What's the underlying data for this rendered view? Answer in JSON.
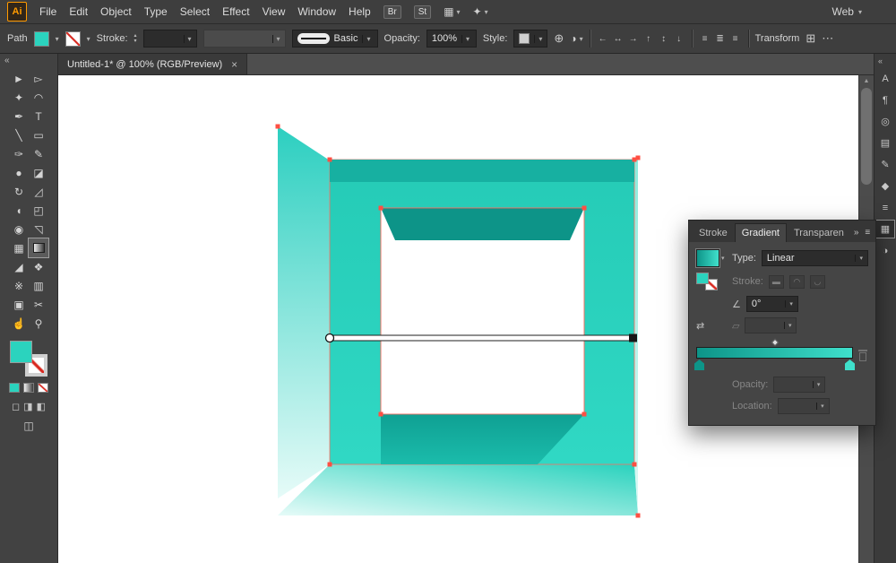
{
  "colors": {
    "teal": "#2BD3BE",
    "teal_dark": "#0D9488",
    "teal_light": "#D9F8F3",
    "anchor_red": "#FF4F43",
    "bar_bg": "#3E3E3E",
    "panel_bg": "#454545",
    "canvas_bg": "#FFFFFF"
  },
  "glyphs": {
    "caret": "▾",
    "stepper_up": "▴",
    "stepper_down": "▾",
    "scroll_up": "▲"
  },
  "menu_bar": {
    "app_badge": "Ai",
    "items": [
      "File",
      "Edit",
      "Object",
      "Type",
      "Select",
      "Effect",
      "View",
      "Window",
      "Help"
    ],
    "bridge_button": "Br",
    "stock_button": "St",
    "arrange_glyph": "▦",
    "live_glyph": "✦",
    "workspace": "Web"
  },
  "control_bar": {
    "selection_label": "Path",
    "stroke_label": "Stroke:",
    "brush_label": "Basic",
    "opacity_label": "Opacity:",
    "opacity_value": "100%",
    "style_label": "Style:",
    "transform_label": "Transform",
    "globe_glyph": "⊕",
    "recolor_glyph": "◑",
    "align_icons": [
      "←",
      "↔",
      "→",
      "↑",
      "↕",
      "↓"
    ],
    "distribute_icons": [
      "≡",
      "≣",
      "≡"
    ],
    "grid_glyph": "⊞",
    "overflow_glyph": "⋯"
  },
  "document_tab": {
    "title": "Untitled-1* @ 100% (RGB/Preview)",
    "close_glyph": "×"
  },
  "toolbar": {
    "collapse_glyph": "«",
    "tools": [
      {
        "name": "selection",
        "glyph": "►"
      },
      {
        "name": "direct-selection",
        "glyph": "▻"
      },
      {
        "name": "magic-wand",
        "glyph": "✦"
      },
      {
        "name": "lasso",
        "glyph": "◠"
      },
      {
        "name": "pen",
        "glyph": "✒"
      },
      {
        "name": "type",
        "glyph": "T"
      },
      {
        "name": "line-segment",
        "glyph": "╲"
      },
      {
        "name": "rectangle",
        "glyph": "▭"
      },
      {
        "name": "paintbrush",
        "glyph": "✑"
      },
      {
        "name": "pencil",
        "glyph": "✎"
      },
      {
        "name": "blob-brush",
        "glyph": "●"
      },
      {
        "name": "eraser",
        "glyph": "◪"
      },
      {
        "name": "rotate",
        "glyph": "↻"
      },
      {
        "name": "scale",
        "glyph": "◿"
      },
      {
        "name": "width",
        "glyph": "◖"
      },
      {
        "name": "free-transform",
        "glyph": "◰"
      },
      {
        "name": "shape-builder",
        "glyph": "◉"
      },
      {
        "name": "perspective-grid",
        "glyph": "◹"
      },
      {
        "name": "mesh",
        "glyph": "▦"
      },
      {
        "name": "gradient",
        "glyph": "■"
      },
      {
        "name": "eyedropper",
        "glyph": "◢"
      },
      {
        "name": "blend",
        "glyph": "❖"
      },
      {
        "name": "symbol-sprayer",
        "glyph": "※"
      },
      {
        "name": "column-graph",
        "glyph": "▥"
      },
      {
        "name": "artboard",
        "glyph": "▣"
      },
      {
        "name": "slice",
        "glyph": "✂"
      },
      {
        "name": "hand",
        "glyph": "☝"
      },
      {
        "name": "zoom",
        "glyph": "⚲"
      }
    ],
    "draw_modes": [
      "◻",
      "◨",
      "◧"
    ],
    "screen_mode": "◫"
  },
  "gradient_panel": {
    "tabs": [
      "Stroke",
      "Gradient",
      "Transparen"
    ],
    "expand_glyph": "»",
    "menu_glyph": "≡",
    "type_label": "Type:",
    "type_value": "Linear",
    "stroke_label": "Stroke:",
    "stroke_type_icons": [
      "▬",
      "◠",
      "◡"
    ],
    "angle_glyph": "∠",
    "angle_value": "0°",
    "reverse_glyph": "⇄",
    "aspect_glyph": "▱",
    "opacity_label": "Opacity:",
    "location_label": "Location:"
  },
  "dock": {
    "expand_glyph": "«",
    "icons": [
      {
        "name": "character-panel",
        "glyph": "A"
      },
      {
        "name": "paragraph-panel",
        "glyph": "¶"
      },
      {
        "name": "appearance-panel",
        "glyph": "◎"
      },
      {
        "name": "swatches-panel",
        "glyph": "▤"
      },
      {
        "name": "brushes-panel",
        "glyph": "✎"
      },
      {
        "name": "symbols-panel",
        "glyph": "◆"
      },
      {
        "name": "stroke-panel",
        "glyph": "≡"
      },
      {
        "name": "gradient-panel",
        "glyph": "▦"
      },
      {
        "name": "transparency-panel",
        "glyph": "◑"
      }
    ]
  }
}
